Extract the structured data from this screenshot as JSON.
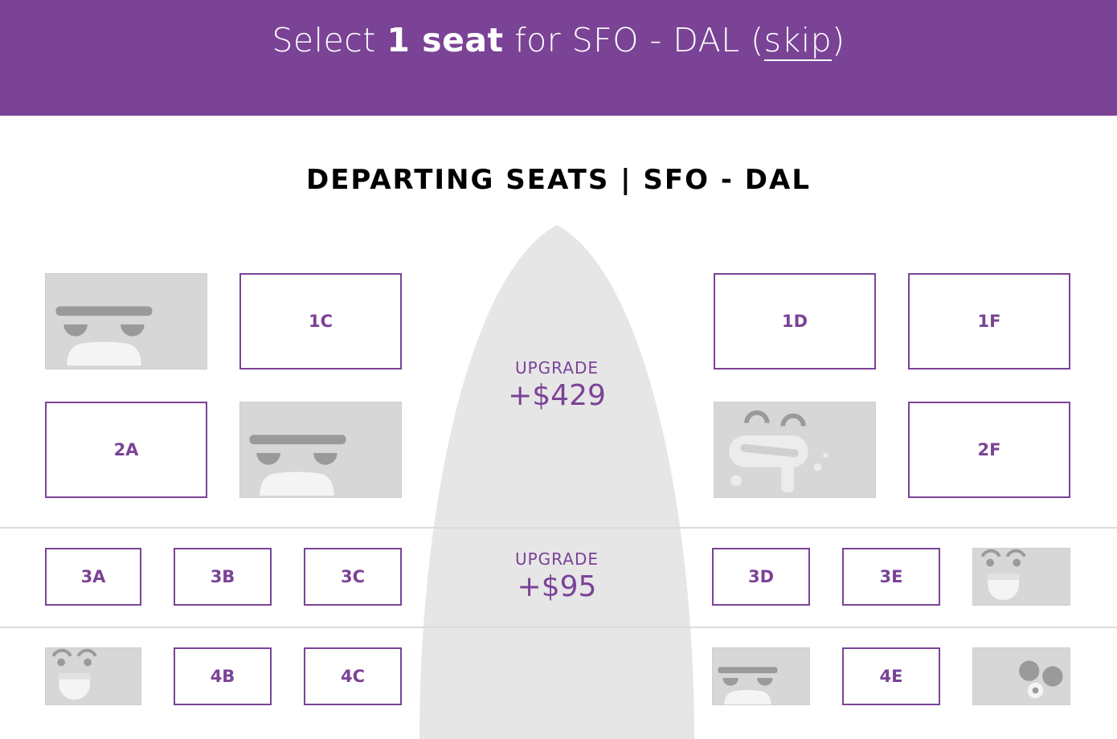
{
  "header": {
    "prefix": "Select ",
    "seat_count": "1 seat",
    "middle": " for SFO - DAL (",
    "skip": "skip",
    "suffix": ")"
  },
  "section_title": "DEPARTING SEATS | SFO - DAL",
  "upgrades": [
    {
      "label": "UPGRADE",
      "price": "+$429"
    },
    {
      "label": "UPGRADE",
      "price": "+$95"
    }
  ],
  "seats": {
    "s1C": "1C",
    "s1D": "1D",
    "s1F": "1F",
    "s2A": "2A",
    "s2F": "2F",
    "s3A": "3A",
    "s3B": "3B",
    "s3C": "3C",
    "s3D": "3D",
    "s3E": "3E",
    "s4B": "4B",
    "s4C": "4C",
    "s4E": "4E"
  },
  "colors": {
    "brand": "#7a4396",
    "occupied": "#d7d7d7",
    "aisle": "#e6e6e6"
  }
}
